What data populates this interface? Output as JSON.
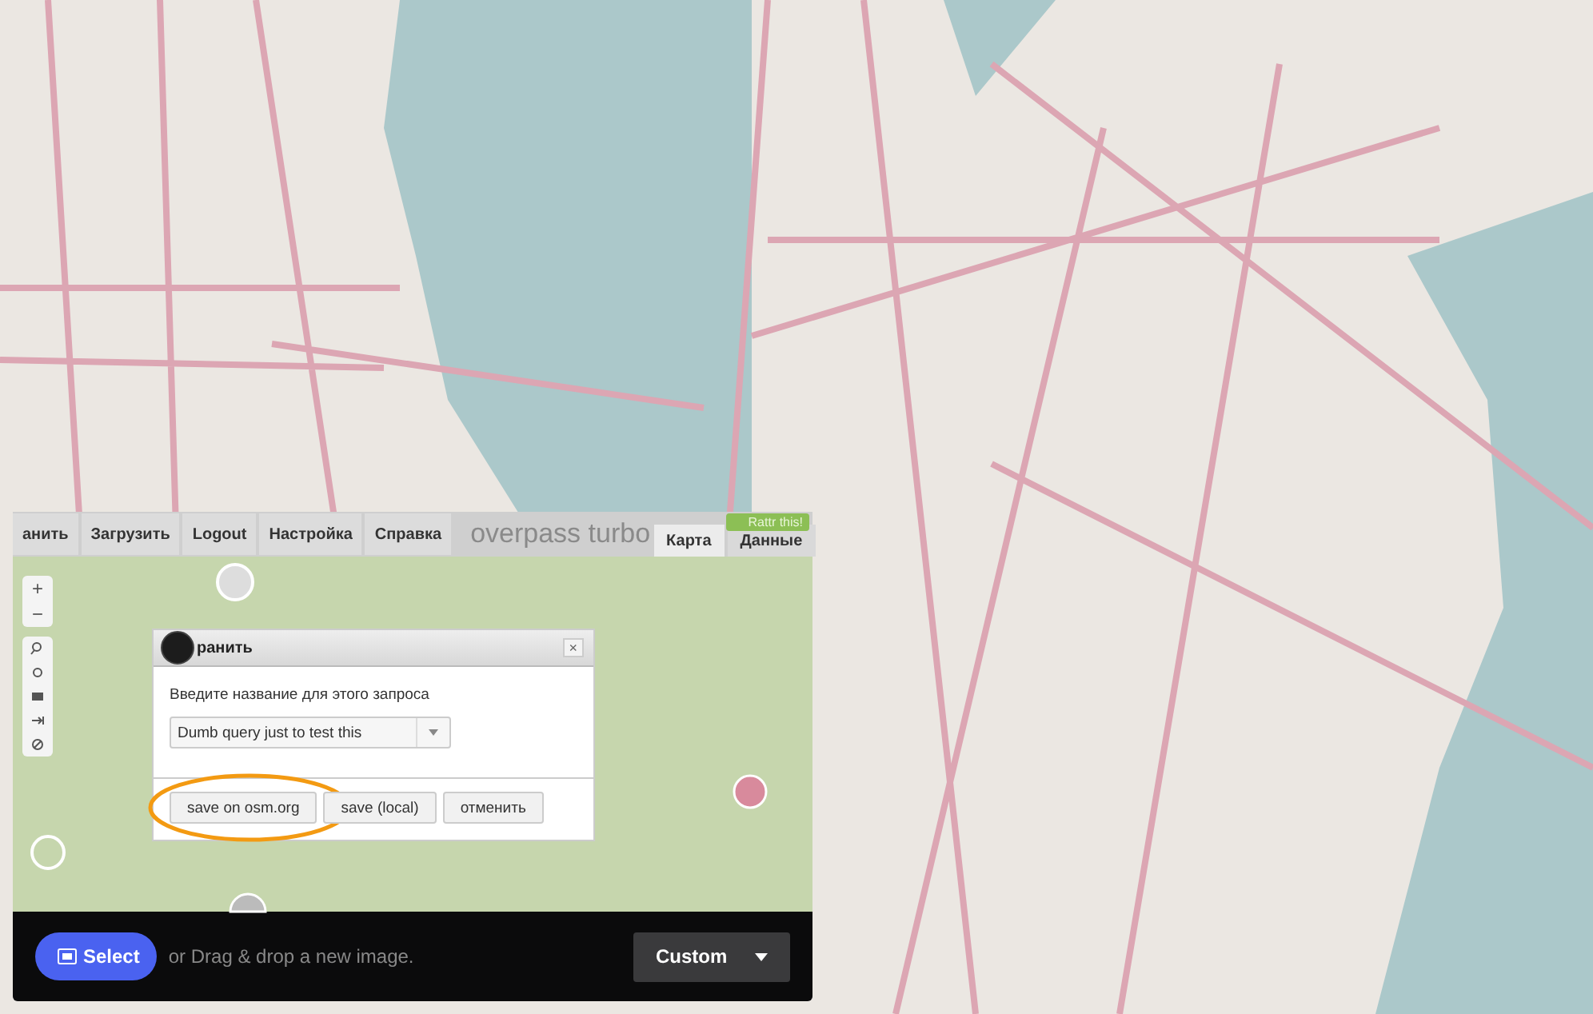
{
  "embedded_window": {
    "menu": [
      {
        "label": "анить"
      },
      {
        "label": "Загрузить"
      },
      {
        "label": "Logout"
      },
      {
        "label": "Настройка"
      },
      {
        "label": "Справка"
      }
    ],
    "title": "overpass turbo",
    "badge": "Rattr this!",
    "tabs": [
      {
        "label": "Карта",
        "selected": true
      },
      {
        "label": "Данные",
        "selected": false
      }
    ],
    "zoom_controls": [
      "+",
      "−"
    ],
    "dialog": {
      "title": "ранить",
      "close": "×",
      "prompt": "Введите название для этого запроса",
      "query_name": "Dumb query just to test this",
      "buttons": [
        {
          "label": "save on osm.org",
          "highlighted": true
        },
        {
          "label": "save (local)",
          "highlighted": false
        },
        {
          "label": "отменить",
          "highlighted": false
        }
      ]
    }
  },
  "toolbar": {
    "select_button": "Select",
    "hint": "or Drag & drop a new image.",
    "preset": "Custom"
  }
}
